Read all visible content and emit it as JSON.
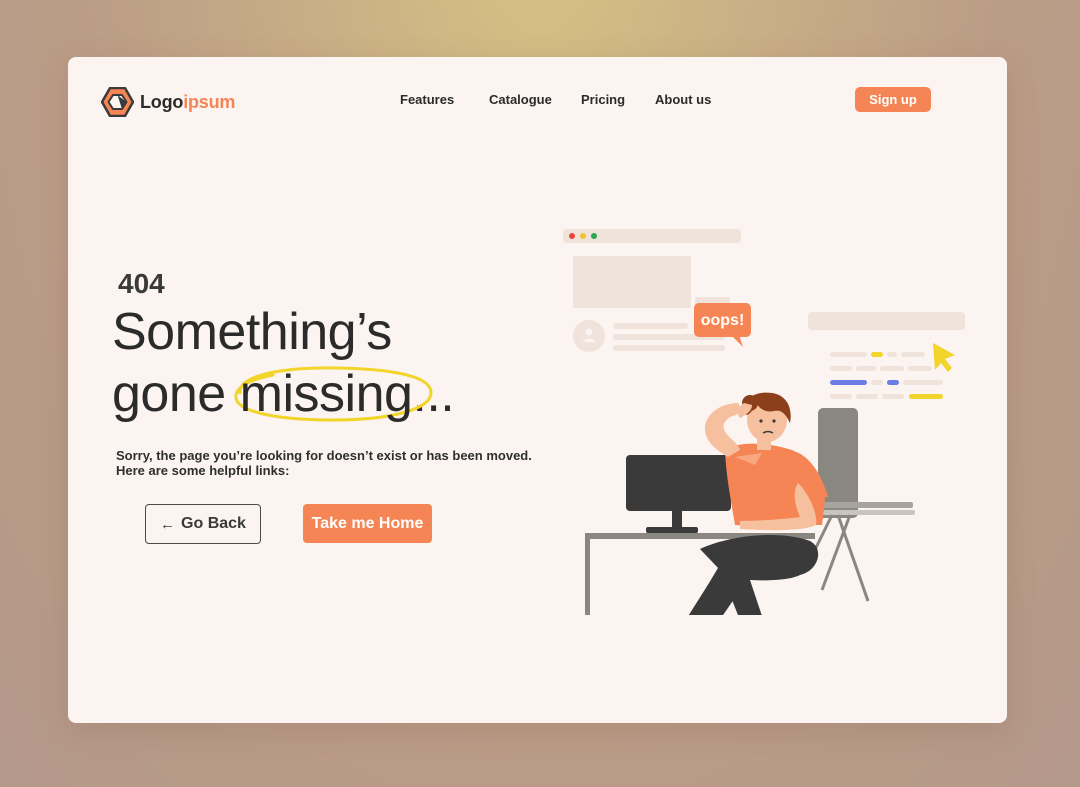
{
  "brand": {
    "logo_main": "Logo",
    "logo_accent": "ipsum"
  },
  "nav": {
    "items": [
      {
        "label": "Features"
      },
      {
        "label": "Catalogue"
      },
      {
        "label": "Pricing"
      },
      {
        "label": "About us"
      }
    ],
    "signup_label": "Sign up"
  },
  "hero": {
    "code": "404",
    "headline_line1": "Something’s",
    "headline_line2_prefix": "gone ",
    "headline_highlight": "missing",
    "headline_suffix": "...",
    "description_line1": "Sorry, the page you’re looking for doesn’t exist or has been moved.",
    "description_line2": "Here are some helpful links:",
    "back_label": "Go Back",
    "home_label": "Take me Home"
  },
  "illustration": {
    "speech_bubble": "oops!"
  },
  "colors": {
    "accent": "#f58554",
    "highlight": "#f2d42b",
    "card_bg": "#fbf4f1",
    "text": "#2b2b2b"
  }
}
